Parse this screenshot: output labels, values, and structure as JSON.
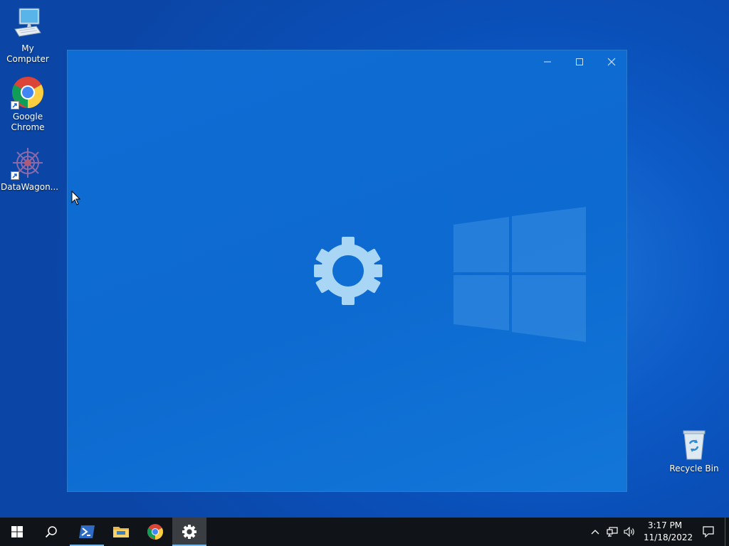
{
  "desktop": {
    "icons": [
      {
        "label": "My Computer",
        "icon": "computer-icon"
      },
      {
        "label": "Google Chrome",
        "icon": "chrome-icon",
        "shortcut": true
      },
      {
        "label": "DataWagon...",
        "icon": "datawagon-icon",
        "shortcut": true
      },
      {
        "label": "Recycle Bin",
        "icon": "recycle-bin-icon"
      }
    ]
  },
  "splash_window": {
    "buttons": [
      "minimize-icon",
      "maximize-icon",
      "close-icon"
    ],
    "center_icon": "settings-gear-icon"
  },
  "taskbar": {
    "items": [
      {
        "name": "start-button",
        "icon": "windows-logo-icon"
      },
      {
        "name": "search-button",
        "icon": "search-icon"
      },
      {
        "name": "powershell-button",
        "icon": "powershell-icon",
        "running": true
      },
      {
        "name": "file-explorer-button",
        "icon": "folder-icon"
      },
      {
        "name": "chrome-button",
        "icon": "chrome-icon"
      },
      {
        "name": "settings-button",
        "icon": "gear-icon",
        "active": true,
        "running": true
      }
    ],
    "tray": {
      "icons": [
        "chevron-up-icon",
        "network-icon",
        "volume-icon"
      ],
      "time": "3:17 PM",
      "date": "11/18/2022",
      "notification_icon": "action-center-icon"
    }
  },
  "colors": {
    "accent": "#76b9ed",
    "desktop_blue": "#0a4fb8",
    "taskbar": "#101418"
  }
}
